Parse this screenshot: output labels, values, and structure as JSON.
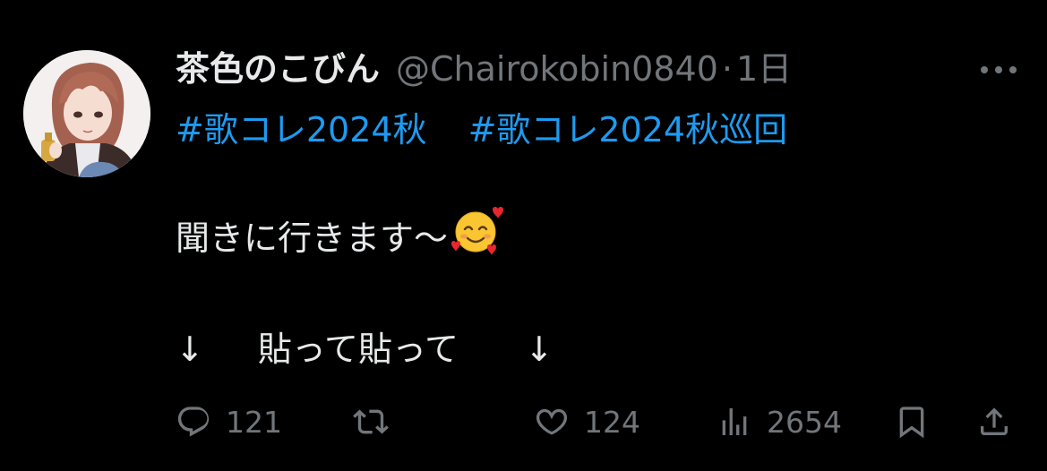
{
  "author": {
    "display_name": "茶色のこびん",
    "handle": "@Chairokobin0840",
    "separator": "·",
    "time": "1日"
  },
  "hashtags": [
    "#歌コレ2024秋",
    "#歌コレ2024秋巡回"
  ],
  "body": {
    "line1": "聞きに行きます〜",
    "emoji": "smiling-face-with-hearts",
    "line2_arrow_left": "↓",
    "line2_text": "貼って貼って",
    "line2_arrow_right": "↓"
  },
  "actions": {
    "replies": "121",
    "likes": "124",
    "views": "2654"
  },
  "colors": {
    "background": "#000000",
    "text": "#e7e9ea",
    "secondary": "#71767b",
    "link": "#1d9bf0"
  }
}
